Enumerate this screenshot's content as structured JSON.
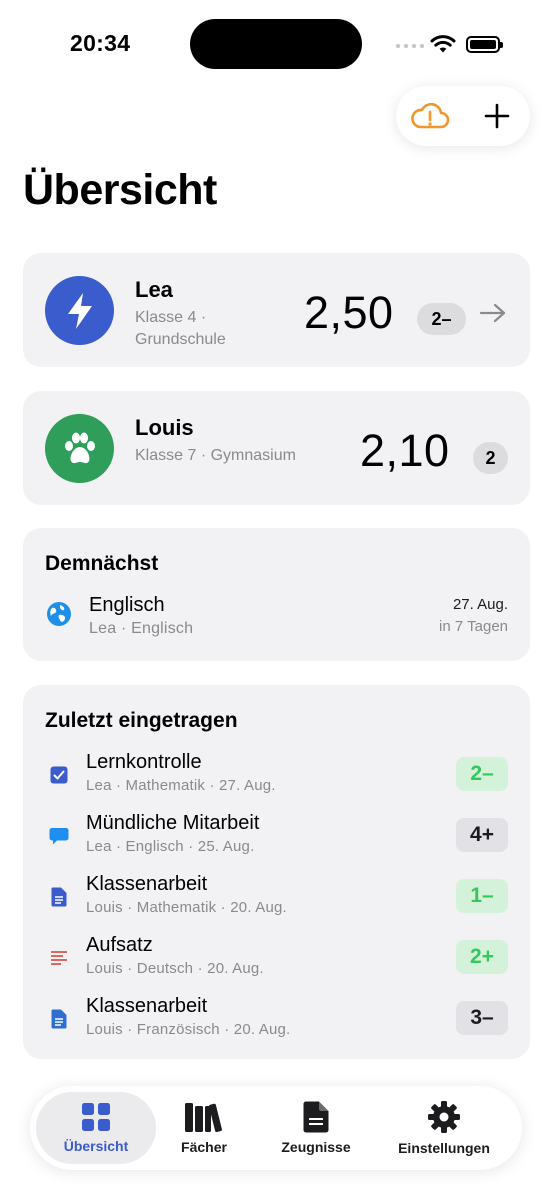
{
  "status": {
    "time": "20:34"
  },
  "page": {
    "title": "Übersicht"
  },
  "children": [
    {
      "name": "Lea",
      "meta": "Klasse 4 · Grundschule",
      "average": "2,50",
      "grade": "2–",
      "color": "#3a5ccc",
      "icon": "bolt-icon"
    },
    {
      "name": "Louis",
      "meta": "Klasse 7 · Gymnasium",
      "average": "2,10",
      "grade": "2",
      "color": "#2f9e5b",
      "icon": "paw-icon"
    }
  ],
  "upcoming": {
    "title": "Demnächst",
    "items": [
      {
        "title": "Englisch",
        "subtitle": "Lea · Englisch",
        "date": "27. Aug.",
        "relative": "in 7 Tagen",
        "icon": "globe-icon"
      }
    ]
  },
  "recent": {
    "title": "Zuletzt eingetragen",
    "items": [
      {
        "title": "Lernkontrolle",
        "subtitle": "Lea · Mathematik · 27. Aug.",
        "grade": "2–",
        "tone": "good",
        "icon": "checkbox-icon"
      },
      {
        "title": "Mündliche Mitarbeit",
        "subtitle": "Lea · Englisch · 25. Aug.",
        "grade": "4+",
        "tone": "neutral",
        "icon": "speech-bubble-icon"
      },
      {
        "title": "Klassenarbeit",
        "subtitle": "Louis · Mathematik · 20. Aug.",
        "grade": "1–",
        "tone": "good",
        "icon": "document-icon"
      },
      {
        "title": "Aufsatz",
        "subtitle": "Louis · Deutsch · 20. Aug.",
        "grade": "2+",
        "tone": "good",
        "icon": "text-lines-icon"
      },
      {
        "title": "Klassenarbeit",
        "subtitle": "Louis · Französisch · 20. Aug.",
        "grade": "3–",
        "tone": "neutral",
        "icon": "document-icon"
      }
    ]
  },
  "tabs": [
    {
      "label": "Übersicht",
      "active": true,
      "icon": "grid-icon"
    },
    {
      "label": "Fächer",
      "active": false,
      "icon": "books-icon"
    },
    {
      "label": "Zeugnisse",
      "active": false,
      "icon": "report-icon"
    },
    {
      "label": "Einstellungen",
      "active": false,
      "icon": "gear-icon"
    }
  ],
  "colors": {
    "accent": "#3a5ccc",
    "good": "#34c759",
    "warning": "#f0962a"
  }
}
